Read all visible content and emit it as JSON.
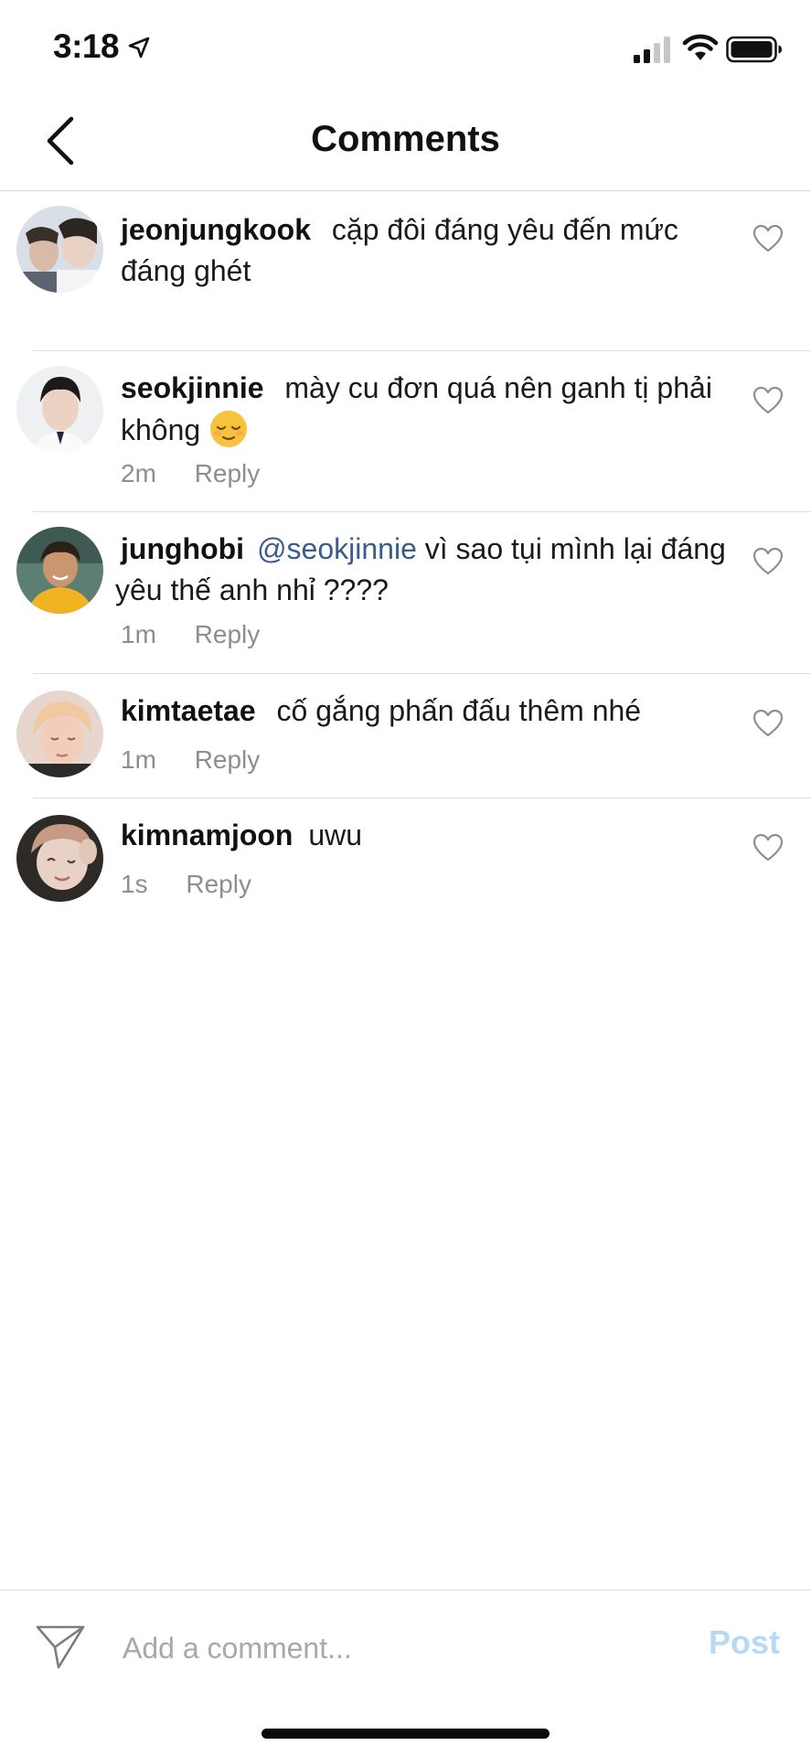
{
  "status_bar": {
    "time": "3:18"
  },
  "header": {
    "title": "Comments"
  },
  "comments": [
    {
      "username": "jeonjungkook",
      "text": "cặp đôi đáng yêu đến mức đáng ghét"
    },
    {
      "username": "seokjinnie",
      "text": "mày cu đơn quá nên ganh tị phải không",
      "emoji": "relieved-face",
      "time": "2m",
      "reply_label": "Reply"
    },
    {
      "username": "junghobi",
      "mention": "@seokjinnie",
      "text": "vì sao tụi mình lại đáng yêu thế anh nhỉ ????",
      "time": "1m",
      "reply_label": "Reply"
    },
    {
      "username": "kimtaetae",
      "text": "cố gắng phấn đấu thêm nhé",
      "time": "1m",
      "reply_label": "Reply"
    },
    {
      "username": "kimnamjoon",
      "text": "uwu",
      "time": "1s",
      "reply_label": "Reply"
    }
  ],
  "comment_bar": {
    "placeholder": "Add a comment...",
    "post_label": "Post"
  },
  "colors": {
    "post_disabled": "#b8d8f4",
    "mention": "#3b5c8a",
    "meta_gray": "#8e8e8e"
  }
}
